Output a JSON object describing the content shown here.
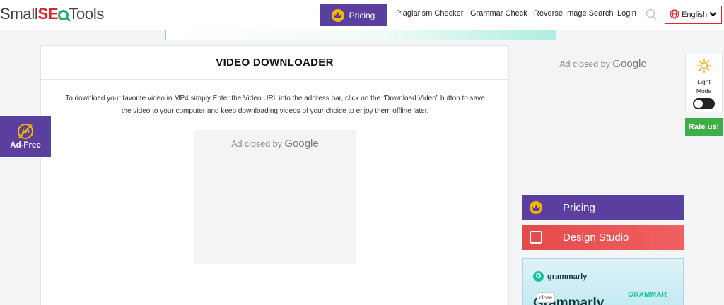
{
  "header": {
    "logo": {
      "part1": "Small",
      "part2": "SE",
      "part3": "Tools"
    },
    "pricing_label": "Pricing",
    "nav": [
      {
        "label": "Plagiarism Checker"
      },
      {
        "label": "Grammar Check"
      },
      {
        "label": "Reverse Image Search"
      },
      {
        "label": "Login"
      }
    ],
    "language": "English"
  },
  "main": {
    "title": "VIDEO DOWNLOADER",
    "description": "To download your favorite video in MP4 simply Enter the Video URL into the address bar, click on the “Download Video” button to save the video to your computer and keep downloading videos of your choice to enjoy them offline later.",
    "ad": {
      "text": "Ad closed by",
      "brand": "Google"
    }
  },
  "right": {
    "ad": {
      "text": "Ad closed by",
      "brand": "Google"
    },
    "pricing_label": "Pricing",
    "design_label": "Design Studio",
    "grammarly": {
      "logo": "grammarly",
      "tag": "GRAMMAR",
      "big": "Grammarly",
      "close": "close"
    }
  },
  "mode": {
    "label_line1": "Light",
    "label_line2": "Mode",
    "dark_on": true
  },
  "rate_label": "Rate us!",
  "adfree": {
    "icon_text": "AD",
    "label": "Ad-Free"
  },
  "colors": {
    "brand_purple": "#5b3f9e",
    "brand_red": "#e0242d",
    "accent_green": "#3fae49",
    "gold": "#f6b900"
  }
}
